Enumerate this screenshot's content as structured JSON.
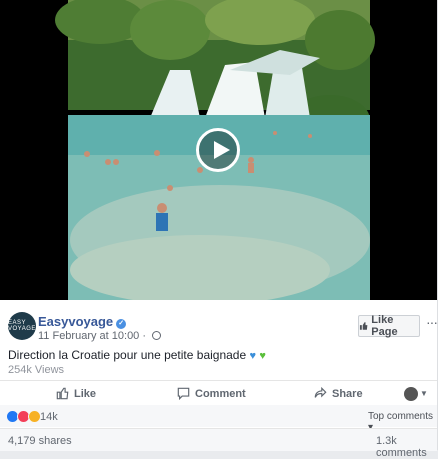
{
  "post": {
    "page_name": "Easyvoyage",
    "date": "11 February at 10:00",
    "meta_separator": "·",
    "like_page_label": "Like Page",
    "more_label": "···",
    "message": "Direction la Croatie pour une petite baignade",
    "views": "254k Views",
    "avatar_text": "EASY VOYAGE"
  },
  "actions": {
    "like_label": "Like",
    "comment_label": "Comment",
    "share_label": "Share"
  },
  "stats": {
    "reaction_count": "14k",
    "top_comments_label": "Top comments ▾",
    "shares": "4,179 shares",
    "comments": "1.3k comments"
  },
  "colors": {
    "link_blue": "#385898",
    "facebook_blue": "#4a90e2"
  }
}
